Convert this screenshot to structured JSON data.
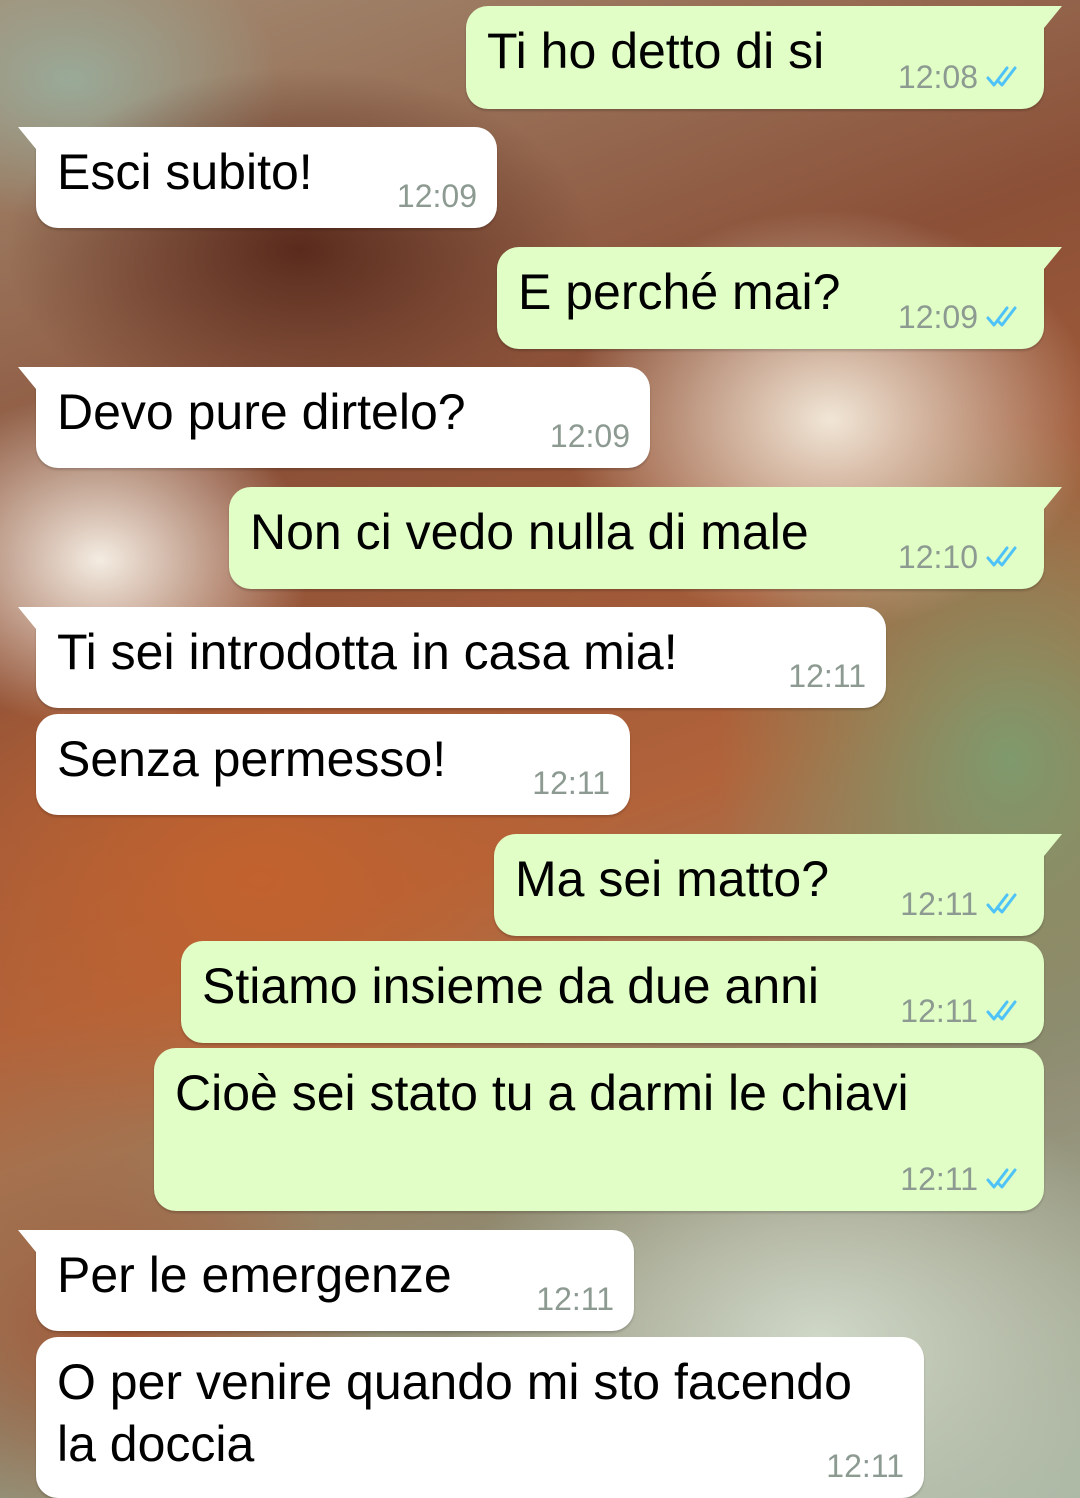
{
  "messages": [
    {
      "text": "Ti ho detto di si",
      "time": "12:08",
      "direction": "out",
      "status": "read"
    },
    {
      "text": "Esci subito!",
      "time": "12:09",
      "direction": "in"
    },
    {
      "text": "E perché mai?",
      "time": "12:09",
      "direction": "out",
      "status": "read"
    },
    {
      "text": "Devo pure dirtelo?",
      "time": "12:09",
      "direction": "in"
    },
    {
      "text": "Non ci vedo nulla di male",
      "time": "12:10",
      "direction": "out",
      "status": "read"
    },
    {
      "text": "Ti sei introdotta in casa mia!",
      "time": "12:11",
      "direction": "in"
    },
    {
      "text": "Senza permesso!",
      "time": "12:11",
      "direction": "in"
    },
    {
      "text": "Ma sei matto?",
      "time": "12:11",
      "direction": "out",
      "status": "read"
    },
    {
      "text": "Stiamo insieme da due anni",
      "time": "12:11",
      "direction": "out",
      "status": "read"
    },
    {
      "text": "Cioè sei stato tu a darmi le chiavi",
      "time": "12:11",
      "direction": "out",
      "status": "read"
    },
    {
      "text": "Per le emergenze",
      "time": "12:11",
      "direction": "in"
    },
    {
      "text": "O per venire quando mi sto facendo\nla doccia",
      "time": "12:11",
      "direction": "in"
    }
  ],
  "colors": {
    "incoming_bubble": "#ffffff",
    "outgoing_bubble": "#e1fec6",
    "read_check": "#4fc3f7",
    "timestamp": "#8c9a91"
  },
  "icons": {
    "read_receipt": "double-check-icon"
  }
}
